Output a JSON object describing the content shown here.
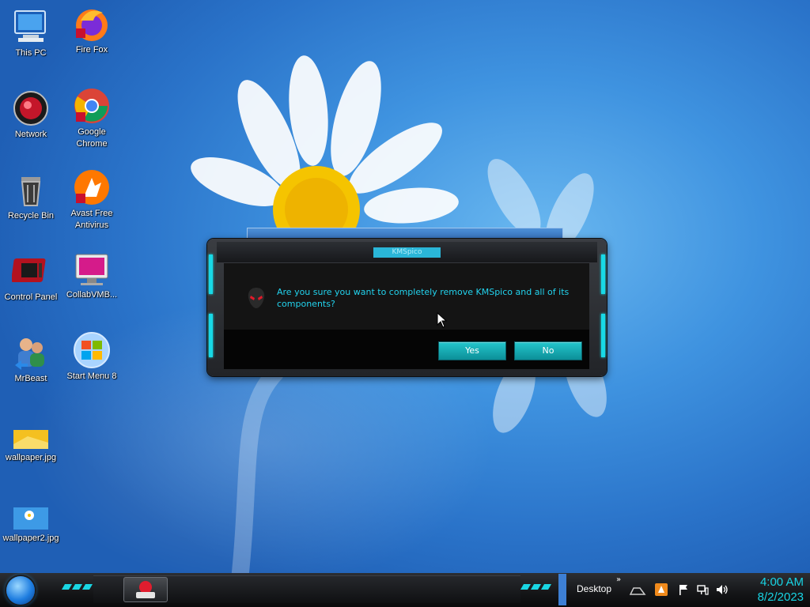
{
  "desktop_icons": [
    {
      "label": "This PC",
      "icon": "computer-icon"
    },
    {
      "label": "Fire Fox",
      "icon": "firefox-icon"
    },
    {
      "label": "Network",
      "icon": "network-icon"
    },
    {
      "label": "Google Chrome",
      "icon": "chrome-icon"
    },
    {
      "label": "Recycle Bin",
      "icon": "recycle-bin-icon"
    },
    {
      "label": "Avast Free Antivirus",
      "icon": "avast-icon"
    },
    {
      "label": "Control Panel",
      "icon": "control-panel-icon"
    },
    {
      "label": "CollabVMB...",
      "icon": "collabvm-icon"
    },
    {
      "label": "MrBeast",
      "icon": "users-icon"
    },
    {
      "label": "Start Menu 8",
      "icon": "windows-logo-icon"
    },
    {
      "label": "wallpaper.jpg",
      "icon": "image-file-icon"
    },
    {
      "label": "wallpaper2.jpg",
      "icon": "image-file-icon"
    }
  ],
  "dialog": {
    "title": "KMSpico",
    "message": "Are you sure you want to completely remove KMSpico and all of its components?",
    "yes_label": "Yes",
    "no_label": "No",
    "accent_color": "#22d3ee"
  },
  "taskbar": {
    "desktop_label": "Desktop",
    "overflow_label": "»",
    "time": "4:00 AM",
    "date": "8/2/2023"
  }
}
